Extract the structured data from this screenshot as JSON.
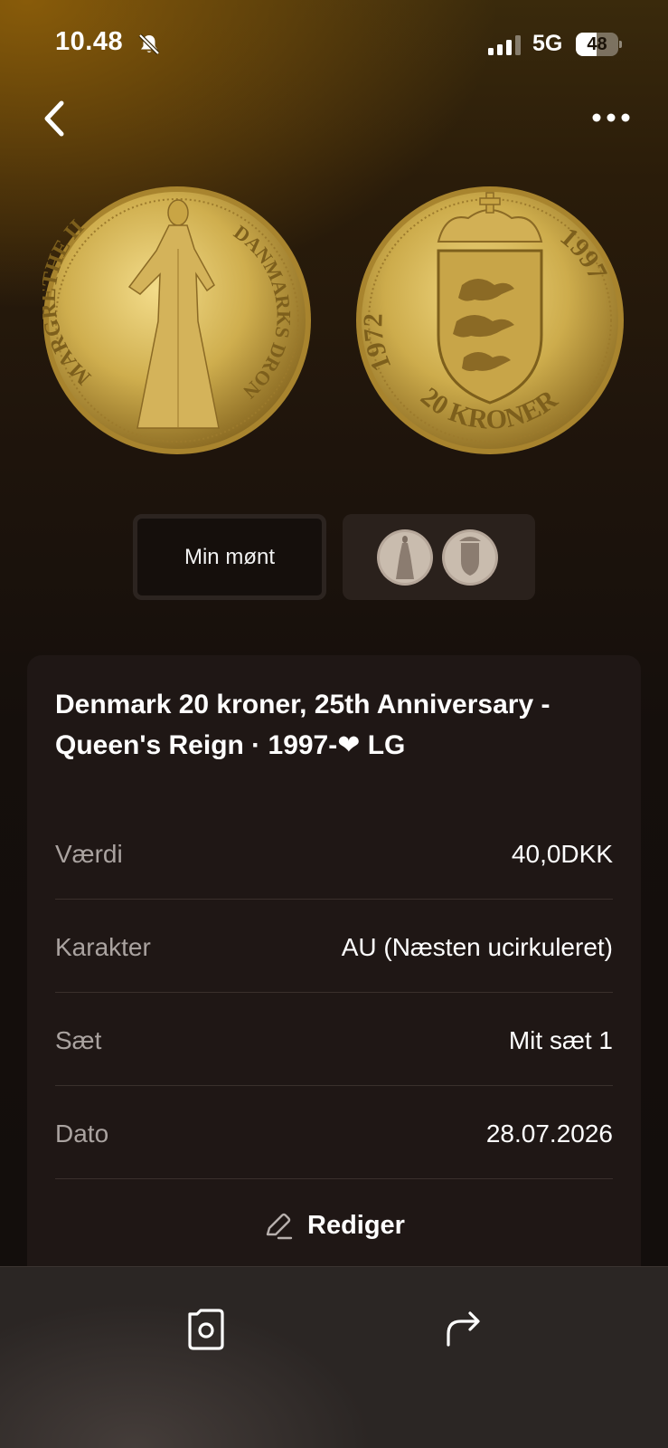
{
  "status_bar": {
    "time": "10.48",
    "network": "5G",
    "battery": "48",
    "battery_level": 0.48,
    "icons": [
      "bell-slash-icon",
      "signal-icon"
    ]
  },
  "nav": {
    "back_icon": "chevron-left-icon",
    "more_icon": "ellipsis-icon"
  },
  "coin_images": {
    "obverse": {
      "legend_top": "MARGRETHE II",
      "legend_right": "DANMARKS DRONNING"
    },
    "reverse": {
      "year_left": "1972",
      "year_right": "1997",
      "denomination": "20 KRONER"
    }
  },
  "image_selector": {
    "my_coin_label": "Min mønt"
  },
  "coin": {
    "title": "Denmark 20 kroner, 25th Anniversary - Queen's Reign · 1997-",
    "title_suffix": " LG",
    "details": [
      {
        "label": "Værdi",
        "value": "40,0DKK"
      },
      {
        "label": "Karakter",
        "value": "AU (Næsten ucirkuleret)"
      },
      {
        "label": "Sæt",
        "value": "Mit sæt 1"
      },
      {
        "label": "Dato",
        "value": "28.07.2026"
      }
    ],
    "edit_label": "Rediger"
  },
  "toolbar": {
    "icons": [
      "camera-icon",
      "share-icon"
    ]
  },
  "colors": {
    "gold": "#c9a640",
    "card_bg": "#1f1715",
    "label_gray": "#aaa3a0"
  }
}
